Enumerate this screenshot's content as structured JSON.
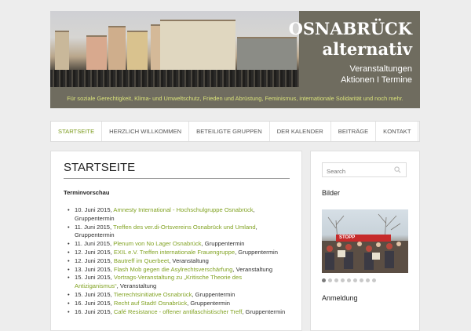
{
  "header": {
    "title_line1": "OSNABRÜCK",
    "title_line2": "alternativ",
    "tagline_line1": "Veranstaltungen",
    "tagline_line2": "Aktionen I Termine",
    "description": "Für soziale Gerechtigkeit, Klima- und Umweltschutz, Frieden und Abrüstung, Feminismus, internationale Solidarität und noch mehr.",
    "colors": {
      "background": "#6f6c5f",
      "description": "#d9e27a"
    }
  },
  "nav": {
    "items": [
      {
        "label": "STARTSEITE",
        "active": true
      },
      {
        "label": "HERZLICH WILLKOMMEN"
      },
      {
        "label": "BETEILIGTE GRUPPEN"
      },
      {
        "label": "DER KALENDER"
      },
      {
        "label": "BEITRÄGE"
      },
      {
        "label": "KONTAKT"
      }
    ]
  },
  "main": {
    "title": "STARTSEITE",
    "section": "Terminvorschau",
    "events": [
      {
        "date": "10. Juni 2015,",
        "link": "Amnesty International - Hochschulgruppe Osnabrück",
        "type": ", Gruppentermin"
      },
      {
        "date": "11. Juni 2015,",
        "link": "Treffen des ver.di-Ortsvereins Osnabrück und Umland",
        "type": ", Gruppentermin"
      },
      {
        "date": "11. Juni 2015,",
        "link": "Plenum von No Lager Osnabrück",
        "type": ", Gruppentermin"
      },
      {
        "date": "12. Juni 2015,",
        "link": "EXIL e.V. Treffen internationale Frauengruppe",
        "type": ", Gruppentermin"
      },
      {
        "date": "12. Juni 2015,",
        "link": "Bautreff im Querbeet",
        "type": ", Veranstaltung"
      },
      {
        "date": "13. Juni 2015,",
        "link": "Flash Mob gegen die Asylrechtsverschärfung",
        "type": ", Veranstaltung"
      },
      {
        "date": "15. Juni 2015,",
        "link": "Vortrags-Veranstaltung zu „Kritische Theorie des Antiziganismus“",
        "type": ", Veranstaltung"
      },
      {
        "date": "15. Juni 2015,",
        "link": "Tierrechtsinitiative Osnabrück",
        "type": ", Gruppentermin"
      },
      {
        "date": "16. Juni 2015,",
        "link": "Recht auf Stadt! Osnabrück",
        "type": ", Gruppentermin"
      },
      {
        "date": "16. Juni 2015,",
        "link": "Café Resistance - offener antifaschistischer Treff",
        "type": ", Gruppentermin"
      }
    ],
    "colors": {
      "link": "#82a324"
    }
  },
  "sidebar": {
    "search_placeholder": "Search",
    "bilder_title": "Bilder",
    "photo_text": "STOPP",
    "anmeldung_title": "Anmeldung"
  }
}
